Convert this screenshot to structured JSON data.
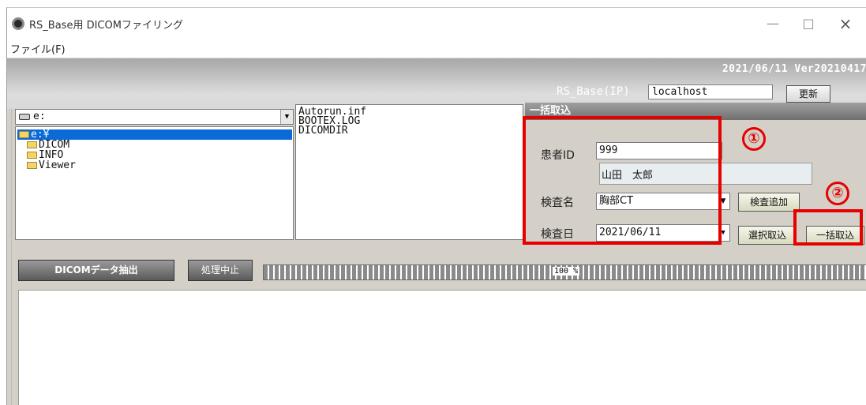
{
  "window": {
    "title": "RS_Base用 DICOMファイリング",
    "minimize": "—",
    "maximize": "□",
    "close": "×"
  },
  "menu": {
    "file": "ファイル(F)"
  },
  "header": {
    "date_version": "2021/06/11 Ver20210417",
    "ip_label": "RS_Base(IP)",
    "ip_value": "localhost",
    "refresh_label": "更新"
  },
  "drive": {
    "value": "e:"
  },
  "tree": {
    "root": "e:¥",
    "children": [
      "DICOM",
      "INFO",
      "Viewer"
    ]
  },
  "files": [
    "Autorun.inf",
    "BOOTEX.LOG",
    "DICOMDIR"
  ],
  "batch": {
    "header": "一括取込",
    "patient_id_label": "患者ID",
    "patient_id_value": "999",
    "patient_name": "山田　太郎",
    "exam_label": "検査名",
    "exam_value": "胸部CT",
    "date_label": "検査日",
    "date_value": "2021/06/11",
    "exam_add_label": "検査追加",
    "select_import_label": "選択取込",
    "batch_import_label": "一括取込"
  },
  "markers": {
    "one": "①",
    "two": "②"
  },
  "actions": {
    "extract_label": "DICOMデータ抽出",
    "stop_label": "処理中止"
  },
  "progress": {
    "percent": 100,
    "label": "100 %"
  },
  "colors": {
    "highlight": "#e60000",
    "selection": "#0a6ad8"
  }
}
